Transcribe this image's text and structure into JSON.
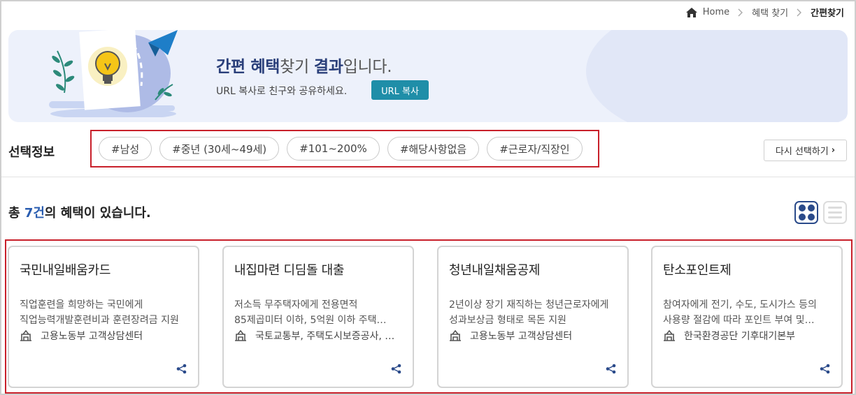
{
  "breadcrumb": {
    "home": "Home",
    "level1": "혜택 찾기",
    "current": "간편찾기"
  },
  "banner": {
    "title_part1": "간편 혜택",
    "title_part2": "찾기 ",
    "title_part3": "결과",
    "title_part4": "입니다.",
    "subtitle": "URL 복사로 친구와 공유하세요.",
    "copy_button": "URL 복사"
  },
  "selection": {
    "label": "선택정보",
    "tags": [
      "#남성",
      "#중년 (30세~49세)",
      "#101~200%",
      "#해당사항없음",
      "#근로자/직장인"
    ],
    "reselect": "다시 선택하기"
  },
  "results": {
    "prefix": "총 ",
    "count": "7건",
    "suffix": "의 혜택이 있습니다.",
    "cards": [
      {
        "title": "국민내일배움카드",
        "desc1": "직업훈련을 희망하는 국민에게",
        "desc2": "직업능력개발훈련비과 훈련장려금 지원",
        "org": "고용노동부 고객상담센터"
      },
      {
        "title": "내집마련 디딤돌 대출",
        "desc1": "저소득 무주택자에게 전용면적",
        "desc2": "85제곱미터 이하, 5억원 이하 주택…",
        "org": "국토교통부, 주택도시보증공사, …"
      },
      {
        "title": "청년내일채움공제",
        "desc1": "2년이상 장기 재직하는 청년근로자에게",
        "desc2": "성과보상금 형태로 목돈 지원",
        "org": "고용노동부 고객상담센터"
      },
      {
        "title": "탄소포인트제",
        "desc1": "참여자에게 전기, 수도, 도시가스 등의",
        "desc2": "사용량 절감에 따라 포인트 부여 및…",
        "org": "한국환경공단 기후대기본부"
      }
    ]
  },
  "icons": [
    "home-icon",
    "chevron-right-icon",
    "grid-view-icon",
    "list-view-icon",
    "building-icon",
    "share-icon"
  ],
  "colors": {
    "accent_teal": "#1f8ea8",
    "navy": "#2a4a8a",
    "highlight_red": "#c8202a",
    "banner_bg": "#edf1fb"
  }
}
